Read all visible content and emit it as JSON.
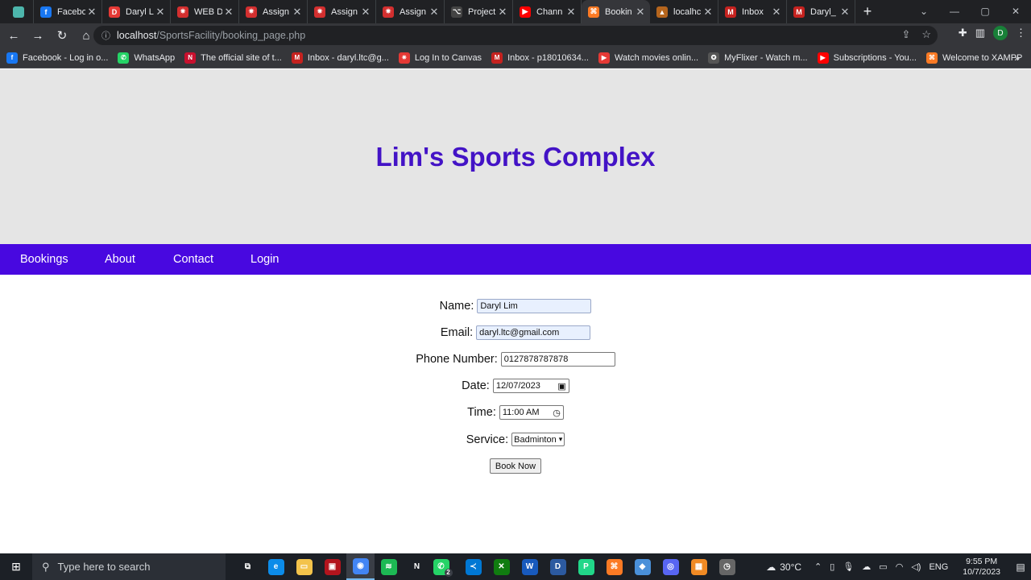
{
  "browser": {
    "tabs": [
      {
        "title": "",
        "color": "#4db6ac",
        "glyph": ""
      },
      {
        "title": "Facebo",
        "color": "#1877f2",
        "glyph": "f"
      },
      {
        "title": "Daryl L",
        "color": "#e53935",
        "glyph": "D"
      },
      {
        "title": "WEB D",
        "color": "#d32f2f",
        "glyph": "✷"
      },
      {
        "title": "Assign",
        "color": "#d32f2f",
        "glyph": "✷"
      },
      {
        "title": "Assign",
        "color": "#d32f2f",
        "glyph": "✷"
      },
      {
        "title": "Assign",
        "color": "#d32f2f",
        "glyph": "✷"
      },
      {
        "title": "Project",
        "color": "#444",
        "glyph": "⌥"
      },
      {
        "title": "Chann",
        "color": "#ff0000",
        "glyph": "▶"
      },
      {
        "title": "Bookin",
        "color": "#fb7a24",
        "glyph": "⌘"
      },
      {
        "title": "localhc",
        "color": "#b5651d",
        "glyph": "▲"
      },
      {
        "title": "Inbox",
        "color": "#c5221f",
        "glyph": "M"
      },
      {
        "title": "Daryl_",
        "color": "#c5221f",
        "glyph": "M"
      }
    ],
    "active_tab_index": 9,
    "url_host": "localhost",
    "url_path": "/SportsFacility/booking_page.php",
    "profile_initial": "D",
    "bookmarks": [
      {
        "label": "Facebook - Log in o...",
        "color": "#1877f2",
        "glyph": "f"
      },
      {
        "label": "WhatsApp",
        "color": "#25d366",
        "glyph": "✆"
      },
      {
        "label": "The official site of t...",
        "color": "#c8102e",
        "glyph": "N"
      },
      {
        "label": "Inbox - daryl.ltc@g...",
        "color": "#c5221f",
        "glyph": "M"
      },
      {
        "label": "Log In to Canvas",
        "color": "#e53935",
        "glyph": "✷"
      },
      {
        "label": "Inbox - p18010634...",
        "color": "#c5221f",
        "glyph": "M"
      },
      {
        "label": "Watch movies onlin...",
        "color": "#e53935",
        "glyph": "▶"
      },
      {
        "label": "MyFlixer - Watch m...",
        "color": "#555",
        "glyph": "✪"
      },
      {
        "label": "Subscriptions - You...",
        "color": "#ff0000",
        "glyph": "▶"
      },
      {
        "label": "Welcome to XAMPP",
        "color": "#fb7a24",
        "glyph": "⌘"
      }
    ]
  },
  "site": {
    "title": "Lim's Sports Complex",
    "nav": [
      "Bookings",
      "About",
      "Contact",
      "Login"
    ]
  },
  "form": {
    "name_label": "Name:",
    "name_value": "Daryl Lim",
    "email_label": "Email:",
    "email_value": "daryl.ltc@gmail.com",
    "phone_label": "Phone Number:",
    "phone_value": "0127878787878",
    "date_label": "Date:",
    "date_value": "12/07/2023",
    "time_label": "Time:",
    "time_value": "11:00 AM",
    "service_label": "Service:",
    "service_value": "Badminton",
    "submit_label": "Book Now"
  },
  "taskbar": {
    "search_placeholder": "Type here to search",
    "apps": [
      {
        "name": "task-view",
        "color": "#1c2026",
        "glyph": "⧉"
      },
      {
        "name": "edge",
        "color": "#0c8ce9",
        "glyph": "e"
      },
      {
        "name": "file-explorer",
        "color": "#f3c34b",
        "glyph": "▭"
      },
      {
        "name": "app-red",
        "color": "#b3141d",
        "glyph": "▣"
      },
      {
        "name": "chrome",
        "color": "#4285f4",
        "glyph": "◉"
      },
      {
        "name": "spotify",
        "color": "#1db954",
        "glyph": "≋"
      },
      {
        "name": "notion",
        "color": "#1c2026",
        "glyph": "N"
      },
      {
        "name": "whatsapp",
        "color": "#25d366",
        "glyph": "✆"
      },
      {
        "name": "vscode",
        "color": "#0078d4",
        "glyph": "≺"
      },
      {
        "name": "xbox",
        "color": "#107c10",
        "glyph": "✕"
      },
      {
        "name": "word",
        "color": "#185abd",
        "glyph": "W"
      },
      {
        "name": "devc",
        "color": "#2c5aa0",
        "glyph": "D"
      },
      {
        "name": "pycharm",
        "color": "#21d789",
        "glyph": "P"
      },
      {
        "name": "xampp",
        "color": "#fb7a24",
        "glyph": "⌘"
      },
      {
        "name": "app-cube",
        "color": "#4a90d9",
        "glyph": "◆"
      },
      {
        "name": "discord",
        "color": "#5865f2",
        "glyph": "◎"
      },
      {
        "name": "app-orange",
        "color": "#f08a24",
        "glyph": "▦"
      },
      {
        "name": "app-clock",
        "color": "#666",
        "glyph": "◷"
      }
    ],
    "active_app": "chrome",
    "whatsapp_badge": "2",
    "temperature": "30°C",
    "language": "ENG",
    "time": "9:55 PM",
    "date": "10/7/2023"
  }
}
